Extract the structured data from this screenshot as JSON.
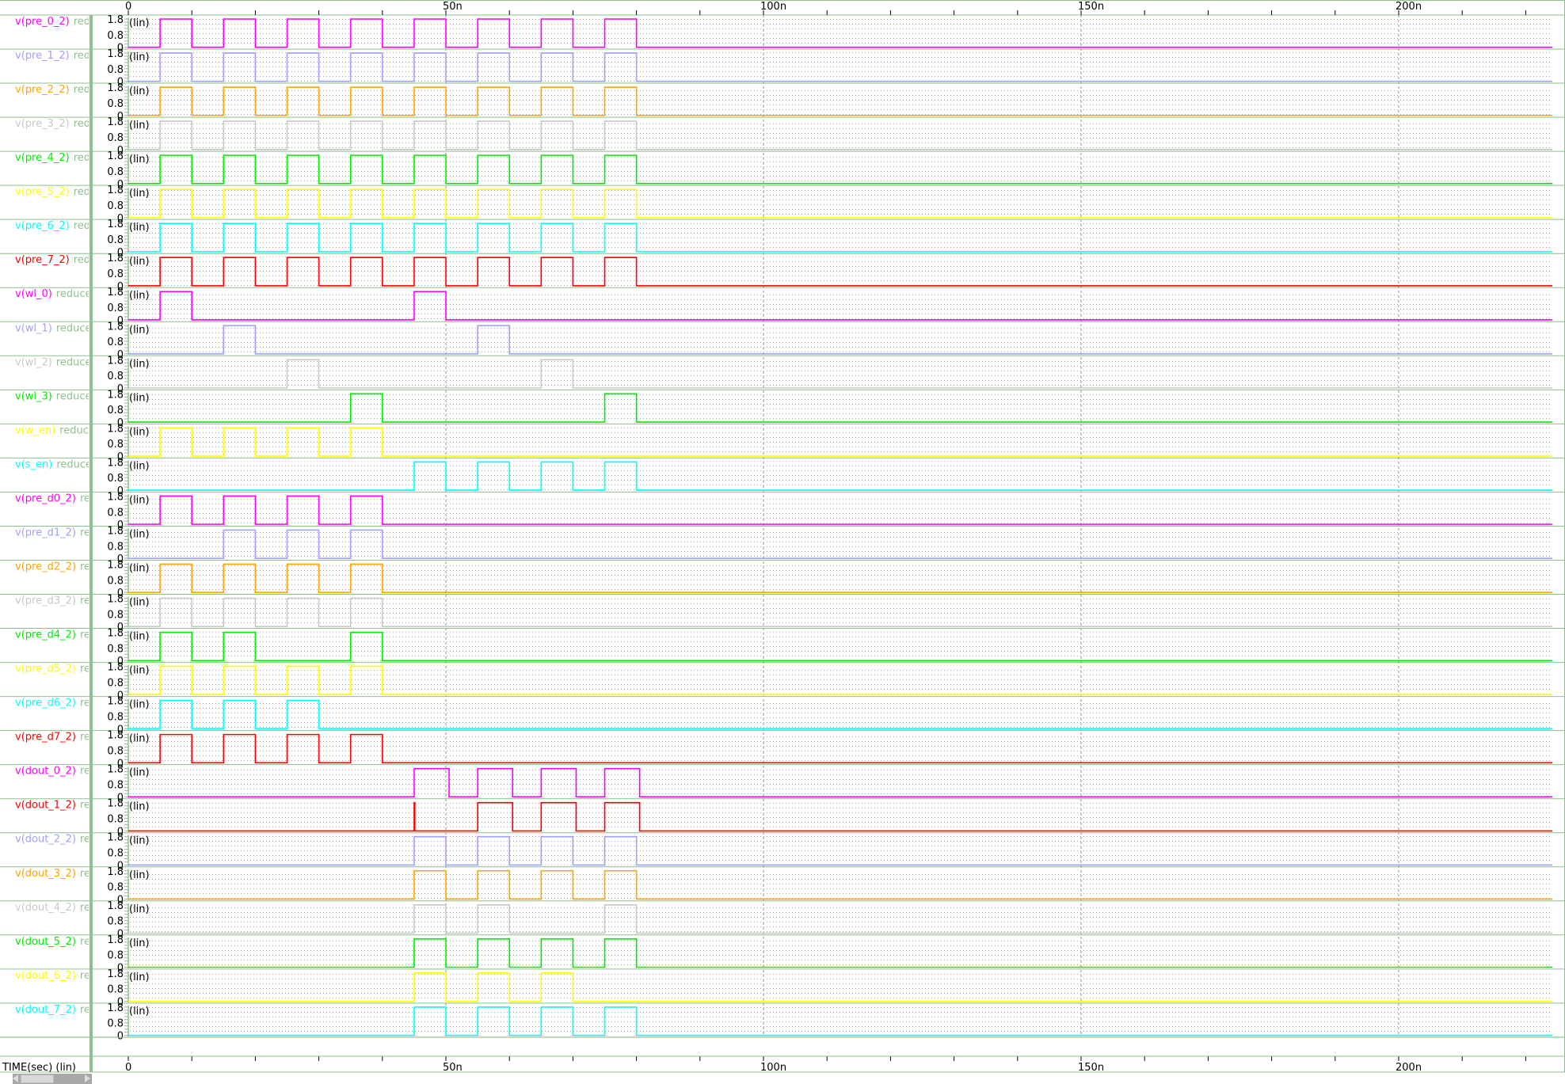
{
  "time_axis": {
    "label": "TIME(sec) (lin)",
    "tick_values": [
      0,
      50,
      100,
      150,
      200
    ],
    "tick_labels": [
      "0",
      "50n",
      "100n",
      "150n",
      "200n"
    ],
    "unit": "ns",
    "range": [
      0,
      224
    ]
  },
  "y_axis": {
    "tick_labels": [
      "1.8",
      "0.8",
      "0"
    ],
    "tick_values": [
      1.8,
      0.8,
      0
    ],
    "scale_label": "(lin)",
    "range": [
      0,
      1.8
    ]
  },
  "colors": {
    "frame": "#8fbf8f",
    "suffix": "#90c090",
    "grid": "#a0a0a0"
  },
  "signals": [
    {
      "name": "v(pre_0_2)",
      "suffix": "reduced",
      "color": "#ff00ff",
      "pulses": [
        [
          5,
          10
        ],
        [
          15,
          20
        ],
        [
          25,
          30
        ],
        [
          35,
          40
        ],
        [
          45,
          50
        ],
        [
          55,
          60
        ],
        [
          65,
          70
        ],
        [
          75,
          80
        ]
      ]
    },
    {
      "name": "v(pre_1_2)",
      "suffix": "reduced",
      "color": "#a0a0ff",
      "pulses": [
        [
          5,
          10
        ],
        [
          15,
          20
        ],
        [
          25,
          30
        ],
        [
          35,
          40
        ],
        [
          45,
          50
        ],
        [
          55,
          60
        ],
        [
          65,
          70
        ],
        [
          75,
          80
        ]
      ]
    },
    {
      "name": "v(pre_2_2)",
      "suffix": "reduced",
      "color": "#ffa500",
      "pulses": [
        [
          5,
          10
        ],
        [
          15,
          20
        ],
        [
          25,
          30
        ],
        [
          35,
          40
        ],
        [
          45,
          50
        ],
        [
          55,
          60
        ],
        [
          65,
          70
        ],
        [
          75,
          80
        ]
      ]
    },
    {
      "name": "v(pre_3_2)",
      "suffix": "reduced",
      "color": "#c8c8c8",
      "pulses": [
        [
          5,
          10
        ],
        [
          15,
          20
        ],
        [
          25,
          30
        ],
        [
          35,
          40
        ],
        [
          45,
          50
        ],
        [
          55,
          60
        ],
        [
          65,
          70
        ],
        [
          75,
          80
        ]
      ]
    },
    {
      "name": "v(pre_4_2)",
      "suffix": "reduced",
      "color": "#00ee00",
      "pulses": [
        [
          5,
          10
        ],
        [
          15,
          20
        ],
        [
          25,
          30
        ],
        [
          35,
          40
        ],
        [
          45,
          50
        ],
        [
          55,
          60
        ],
        [
          65,
          70
        ],
        [
          75,
          80
        ]
      ]
    },
    {
      "name": "v(pre_5_2)",
      "suffix": "reduced",
      "color": "#ffff00",
      "pulses": [
        [
          5,
          10
        ],
        [
          15,
          20
        ],
        [
          25,
          30
        ],
        [
          35,
          40
        ],
        [
          45,
          50
        ],
        [
          55,
          60
        ],
        [
          65,
          70
        ],
        [
          75,
          80
        ]
      ]
    },
    {
      "name": "v(pre_6_2)",
      "suffix": "reduced",
      "color": "#00ffff",
      "pulses": [
        [
          5,
          10
        ],
        [
          15,
          20
        ],
        [
          25,
          30
        ],
        [
          35,
          40
        ],
        [
          45,
          50
        ],
        [
          55,
          60
        ],
        [
          65,
          70
        ],
        [
          75,
          80
        ]
      ]
    },
    {
      "name": "v(pre_7_2)",
      "suffix": "reduced",
      "color": "#ff0000",
      "pulses": [
        [
          5,
          10
        ],
        [
          15,
          20
        ],
        [
          25,
          30
        ],
        [
          35,
          40
        ],
        [
          45,
          50
        ],
        [
          55,
          60
        ],
        [
          65,
          70
        ],
        [
          75,
          80
        ]
      ]
    },
    {
      "name": "v(wl_0)",
      "suffix": "reduced",
      "color": "#ff00ff",
      "pulses": [
        [
          5,
          10
        ],
        [
          45,
          50
        ]
      ]
    },
    {
      "name": "v(wl_1)",
      "suffix": "reduced",
      "color": "#a0a0ff",
      "pulses": [
        [
          15,
          20
        ],
        [
          55,
          60
        ]
      ]
    },
    {
      "name": "v(wl_2)",
      "suffix": "reduced",
      "color": "#c8c8c8",
      "pulses": [
        [
          25,
          30
        ],
        [
          65,
          70
        ]
      ]
    },
    {
      "name": "v(wl_3)",
      "suffix": "reduced",
      "color": "#00ee00",
      "pulses": [
        [
          35,
          40
        ],
        [
          75,
          80
        ]
      ]
    },
    {
      "name": "v(w_en)",
      "suffix": "reduced",
      "color": "#ffff00",
      "pulses": [
        [
          5,
          10
        ],
        [
          15,
          20
        ],
        [
          25,
          30
        ],
        [
          35,
          40
        ]
      ]
    },
    {
      "name": "v(s_en)",
      "suffix": "reduced",
      "color": "#00ffff",
      "pulses": [
        [
          45,
          50
        ],
        [
          55,
          60
        ],
        [
          65,
          70
        ],
        [
          75,
          80
        ]
      ]
    },
    {
      "name": "v(pre_d0_2)",
      "suffix": "reduced",
      "color": "#ff00ff",
      "pulses": [
        [
          5,
          10
        ],
        [
          15,
          20
        ],
        [
          25,
          30
        ],
        [
          35,
          40
        ]
      ]
    },
    {
      "name": "v(pre_d1_2)",
      "suffix": "reduced",
      "color": "#a0a0ff",
      "pulses": [
        [
          15,
          20
        ],
        [
          25,
          30
        ],
        [
          35,
          40
        ]
      ]
    },
    {
      "name": "v(pre_d2_2)",
      "suffix": "reduced",
      "color": "#ffa500",
      "pulses": [
        [
          5,
          10
        ],
        [
          15,
          20
        ],
        [
          25,
          30
        ],
        [
          35,
          40
        ]
      ]
    },
    {
      "name": "v(pre_d3_2)",
      "suffix": "reduced",
      "color": "#c8c8c8",
      "pulses": [
        [
          5,
          10
        ],
        [
          15,
          20
        ],
        [
          25,
          30
        ],
        [
          35,
          40
        ]
      ]
    },
    {
      "name": "v(pre_d4_2)",
      "suffix": "reduced",
      "color": "#00ee00",
      "pulses": [
        [
          5,
          10
        ],
        [
          15,
          20
        ],
        [
          35,
          40
        ]
      ]
    },
    {
      "name": "v(pre_d5_2)",
      "suffix": "reduced",
      "color": "#ffff00",
      "pulses": [
        [
          5,
          10
        ],
        [
          15,
          20
        ],
        [
          25,
          30
        ],
        [
          35,
          40
        ]
      ]
    },
    {
      "name": "v(pre_d6_2)",
      "suffix": "reduced",
      "color": "#00ffff",
      "pulses": [
        [
          5,
          10
        ],
        [
          15,
          20
        ],
        [
          25,
          30
        ]
      ]
    },
    {
      "name": "v(pre_d7_2)",
      "suffix": "reduced",
      "color": "#ff0000",
      "pulses": [
        [
          5,
          10
        ],
        [
          15,
          20
        ],
        [
          25,
          30
        ],
        [
          35,
          40
        ]
      ]
    },
    {
      "name": "v(dout_0_2)",
      "suffix": "reduced",
      "color": "#ff00ff",
      "pulses": [
        [
          45,
          50.5
        ],
        [
          55,
          60.5
        ],
        [
          65,
          70.5
        ],
        [
          75,
          80.5
        ]
      ]
    },
    {
      "name": "v(dout_1_2)",
      "suffix": "reduced",
      "color": "#ff0000",
      "pulses": [
        [
          45,
          45.1
        ],
        [
          55,
          60.5
        ],
        [
          65,
          70.5
        ],
        [
          75,
          80.5
        ]
      ]
    },
    {
      "name": "v(dout_2_2)",
      "suffix": "reduced",
      "color": "#a0a0ff",
      "pulses": [
        [
          45,
          50
        ],
        [
          55,
          60
        ],
        [
          65,
          70
        ],
        [
          75,
          80
        ]
      ]
    },
    {
      "name": "v(dout_3_2)",
      "suffix": "reduced",
      "color": "#ffa500",
      "pulses": [
        [
          45,
          50
        ],
        [
          55,
          60
        ],
        [
          65,
          70
        ],
        [
          75,
          80
        ]
      ]
    },
    {
      "name": "v(dout_4_2)",
      "suffix": "reduced",
      "color": "#c8c8c8",
      "pulses": [
        [
          45,
          50
        ],
        [
          55,
          60
        ],
        [
          75,
          80
        ]
      ]
    },
    {
      "name": "v(dout_5_2)",
      "suffix": "reduced",
      "color": "#00ee00",
      "pulses": [
        [
          45,
          50
        ],
        [
          55,
          60
        ],
        [
          65,
          70
        ],
        [
          75,
          80
        ]
      ]
    },
    {
      "name": "v(dout_6_2)",
      "suffix": "reduced",
      "color": "#ffff00",
      "pulses": [
        [
          45,
          50
        ],
        [
          55,
          60
        ],
        [
          65,
          70
        ]
      ]
    },
    {
      "name": "v(dout_7_2)",
      "suffix": "reduced",
      "color": "#00ffff",
      "pulses": [
        [
          45,
          50
        ],
        [
          55,
          60
        ],
        [
          65,
          70
        ],
        [
          75,
          80
        ]
      ]
    }
  ]
}
